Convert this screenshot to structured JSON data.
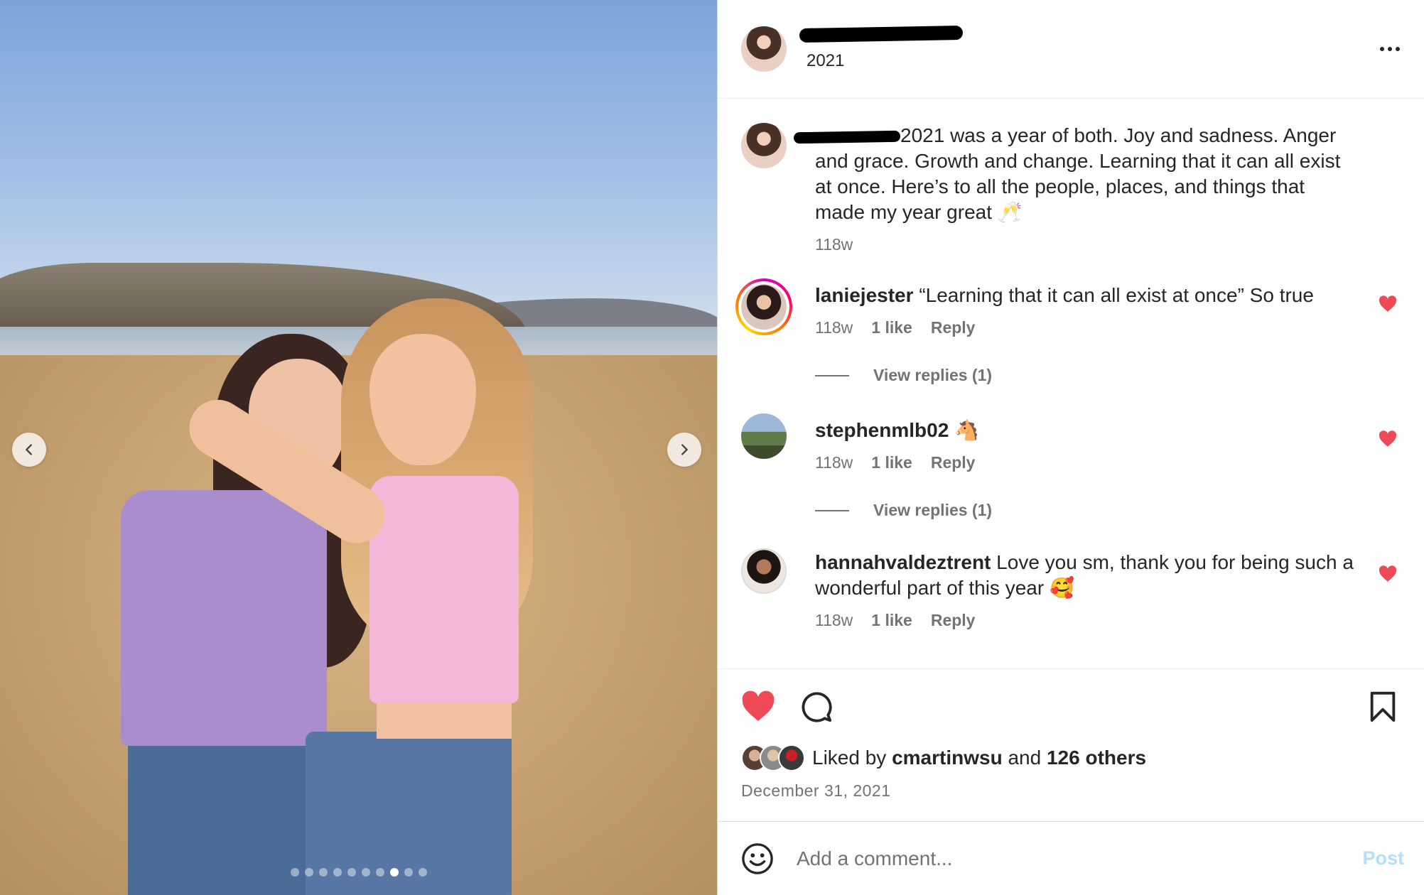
{
  "post": {
    "header_subtitle": "2021",
    "caption": "2021 was a year of both. Joy and sadness. Anger and grace. Growth and change. Learning that it can all exist at once. Here’s to all the people, places, and things that made my year great 🥂",
    "caption_age": "118w"
  },
  "comments": [
    {
      "username": "laniejester",
      "text": "“Learning that it can all exist at once” So true",
      "age": "118w",
      "likes": "1 like",
      "reply_label": "Reply",
      "view_replies": "View replies (1)"
    },
    {
      "username": "stephenmlb02",
      "text": "🐴",
      "age": "118w",
      "likes": "1 like",
      "reply_label": "Reply",
      "view_replies": "View replies (1)"
    },
    {
      "username": "hannahvaldeztrent",
      "text": "Love you sm, thank you for being such a wonderful part of this year 🥰",
      "age": "118w",
      "likes": "1 like",
      "reply_label": "Reply"
    }
  ],
  "likes": {
    "prefix": "Liked by",
    "user": "cmartinwsu",
    "joiner": "and",
    "others": "126 others"
  },
  "date": "December 31, 2021",
  "add_comment": {
    "placeholder": "Add a comment...",
    "post_label": "Post"
  },
  "carousel": {
    "slide_count": 10,
    "active_index": 7
  },
  "colors": {
    "heart": "#ed4956",
    "post_disabled": "#b2dffc",
    "meta": "#737373"
  },
  "icons": [
    "chevron-left-icon",
    "chevron-right-icon",
    "more-icon",
    "heart-icon",
    "comment-icon",
    "bookmark-icon",
    "emoji-icon"
  ]
}
